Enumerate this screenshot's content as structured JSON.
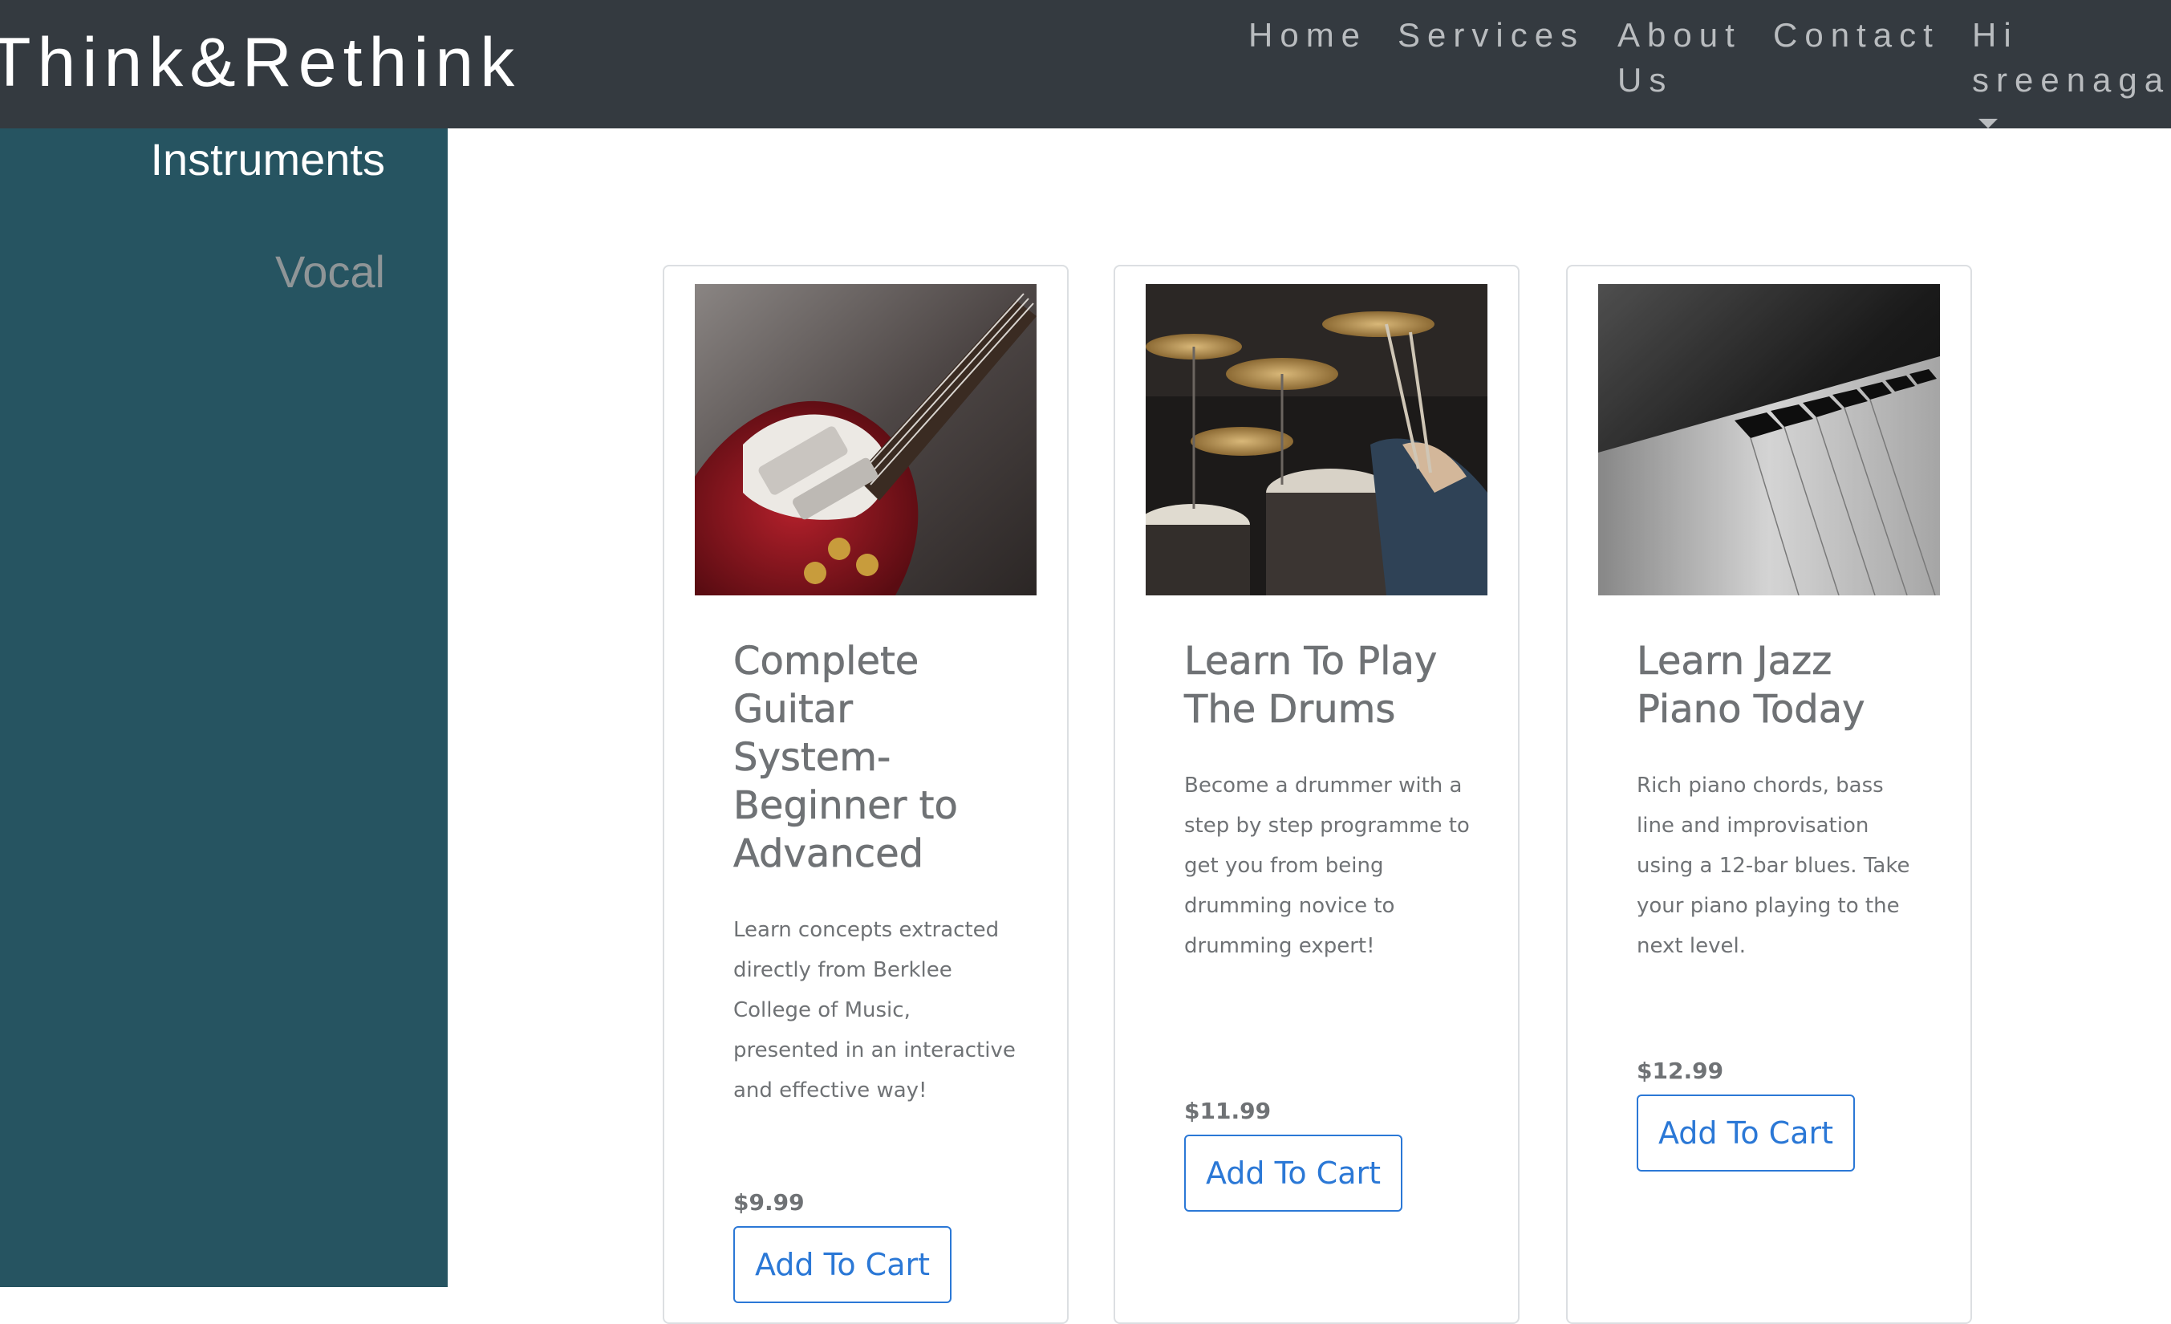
{
  "navbar": {
    "brand": "Think&Rethink",
    "links": {
      "home": "Home",
      "services": "Services",
      "about": "About Us",
      "contact": "Contact",
      "user": "Hi sreenaga"
    }
  },
  "sidebar": {
    "items": [
      {
        "label": "Instruments",
        "active": true
      },
      {
        "label": "Vocal",
        "active": false
      }
    ]
  },
  "products": [
    {
      "image": "electric-guitar-photo",
      "title": "Complete Guitar System-Beginner to Advanced",
      "description": "Learn concepts extracted directly from Berklee College of Music, presented in an interactive and effective way!",
      "price": "$9.99",
      "button": "Add To Cart"
    },
    {
      "image": "drum-kit-photo",
      "title": "Learn To Play The Drums",
      "description": "Become a drummer with a step by step programme to get you from being drumming novice to drumming expert!",
      "price": "$11.99",
      "button": "Add To Cart"
    },
    {
      "image": "piano-keys-photo",
      "title": "Learn Jazz Piano Today",
      "description": "Rich piano chords, bass line and improvisation using a 12-bar blues. Take your piano playing to the next level.",
      "price": "$12.99",
      "button": "Add To Cart"
    }
  ],
  "colors": {
    "navbar": "#343a40",
    "sidebar": "#265461",
    "button_accent": "#2b78d6",
    "body_text": "#6f7275"
  }
}
